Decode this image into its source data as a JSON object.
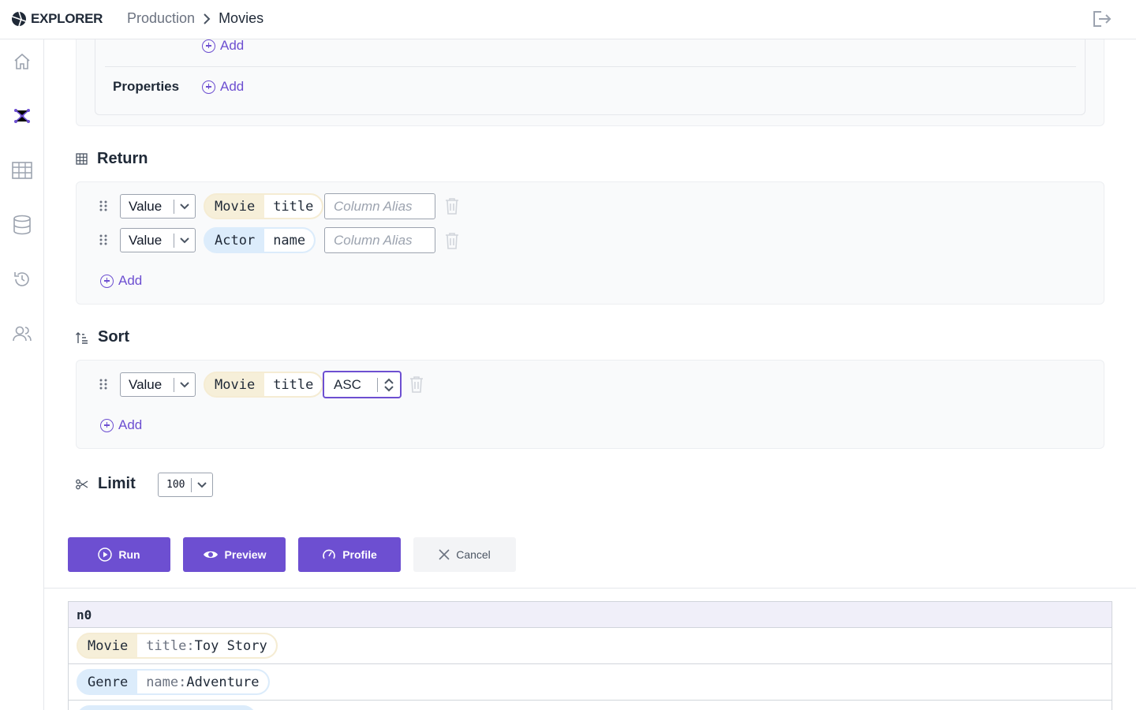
{
  "app": {
    "name": "EXPLORER"
  },
  "breadcrumb": {
    "parent": "Production",
    "current": "Movies"
  },
  "sidebar": {
    "items": [
      "home-icon",
      "graph-icon",
      "table-icon",
      "database-icon",
      "history-icon",
      "users-icon"
    ]
  },
  "match_panel": {
    "add_label": "Add",
    "properties_label": "Properties",
    "properties_add_label": "Add"
  },
  "return_section": {
    "title": "Return",
    "rows": [
      {
        "type": "Value",
        "label": "Movie",
        "property": "title",
        "alias_placeholder": "Column Alias"
      },
      {
        "type": "Value",
        "label": "Actor",
        "property": "name",
        "alias_placeholder": "Column Alias"
      }
    ],
    "add_label": "Add"
  },
  "sort_section": {
    "title": "Sort",
    "rows": [
      {
        "type": "Value",
        "label": "Movie",
        "property": "title",
        "direction": "ASC"
      }
    ],
    "add_label": "Add"
  },
  "limit_section": {
    "title": "Limit",
    "value": "100"
  },
  "actions": {
    "run": "Run",
    "preview": "Preview",
    "profile": "Profile",
    "cancel": "Cancel"
  },
  "results": {
    "column": "n0",
    "rows": [
      {
        "label": "Movie",
        "key": "title",
        "value": "Toy Story"
      },
      {
        "label": "Genre",
        "key": "name",
        "value": "Adventure"
      }
    ]
  },
  "colors": {
    "accent": "#6d4fd1",
    "movie_label_bg": "#f6efd9",
    "actor_label_bg": "#dcecfb"
  }
}
